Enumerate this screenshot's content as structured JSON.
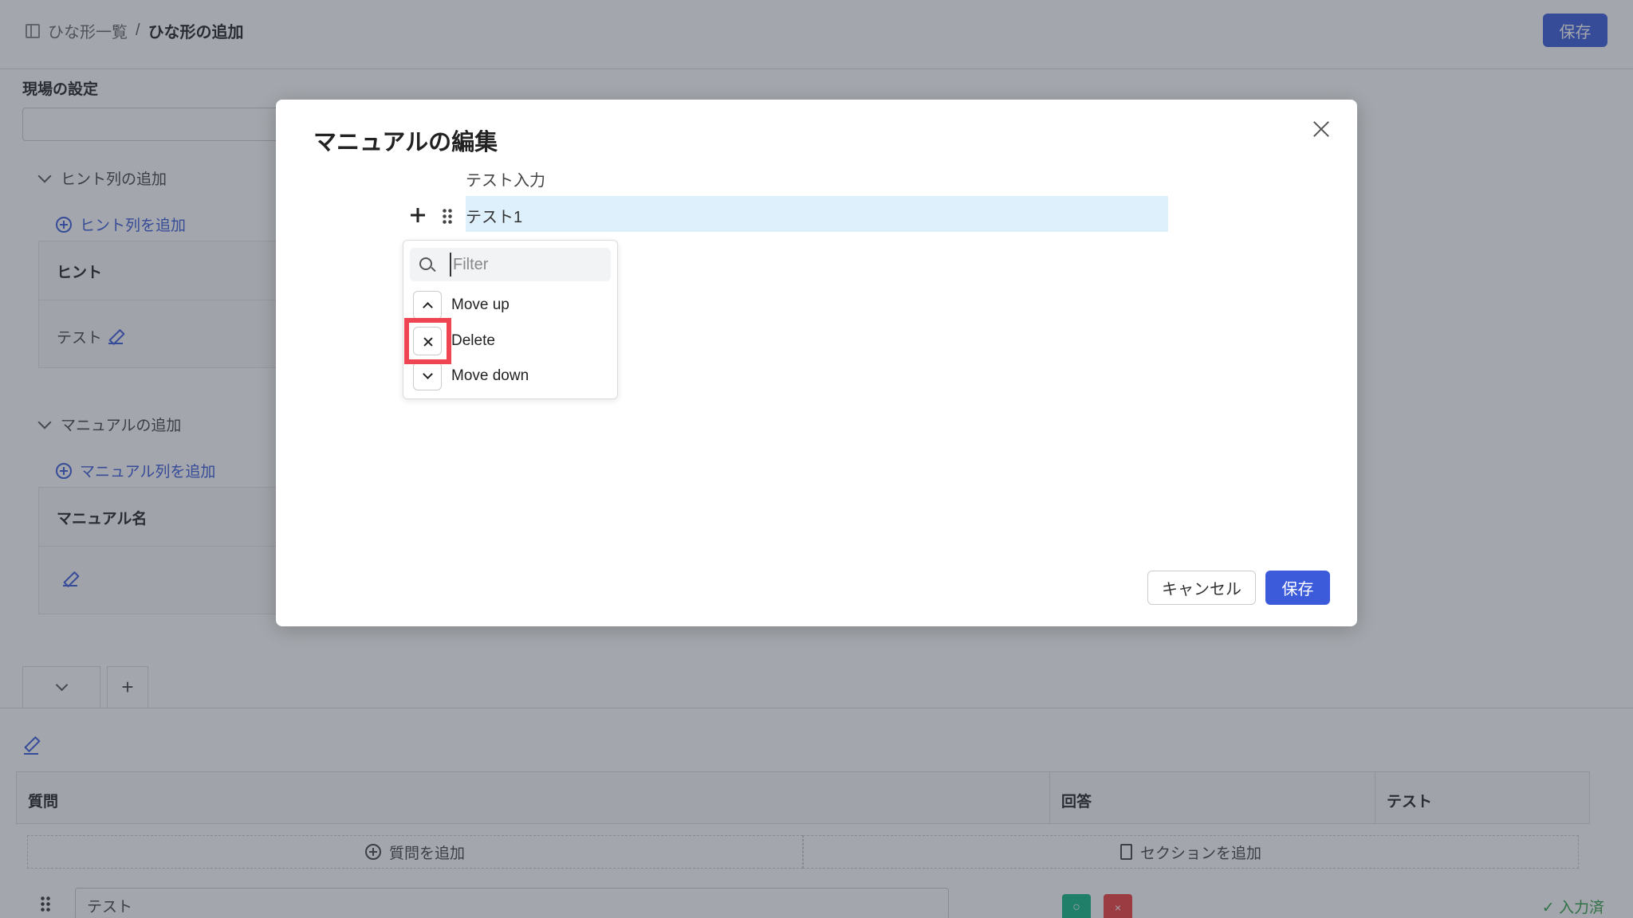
{
  "header": {
    "breadcrumb_parent": "ひな形一覧",
    "breadcrumb_separator": "/",
    "breadcrumb_current": "ひな形の追加",
    "save_label": "保存"
  },
  "site_settings": {
    "label": "現場の設定"
  },
  "hint_section": {
    "toggle_label": "ヒント列の追加",
    "add_link": "ヒント列を追加",
    "column_header": "ヒント",
    "row_text": "テスト"
  },
  "manual_section": {
    "toggle_label": "マニュアルの追加",
    "add_link": "マニュアル列を追加",
    "column_header": "マニュアル名"
  },
  "question_table": {
    "headers": [
      "質問",
      "回答",
      "テスト"
    ],
    "add_question": "質問を追加",
    "add_section": "セクションを追加",
    "row_value": "テスト",
    "answer_ok": "○",
    "answer_ng": "×",
    "status": "✓ 入力済"
  },
  "modal": {
    "title": "マニュアルの編集",
    "editor_label": "テスト入力",
    "selected_block_text": "テスト1",
    "filter_placeholder": "Filter",
    "menu_items": [
      "Move up",
      "Delete",
      "Move down"
    ],
    "cancel_label": "キャンセル",
    "save_label": "保存"
  },
  "colors": {
    "accent": "#3b5bdb",
    "highlight": "#ef4452",
    "selected_block": "#dff0fd",
    "ok_button": "#12b886",
    "ng_button": "#f03e3e",
    "done_text": "#2f9e44"
  }
}
